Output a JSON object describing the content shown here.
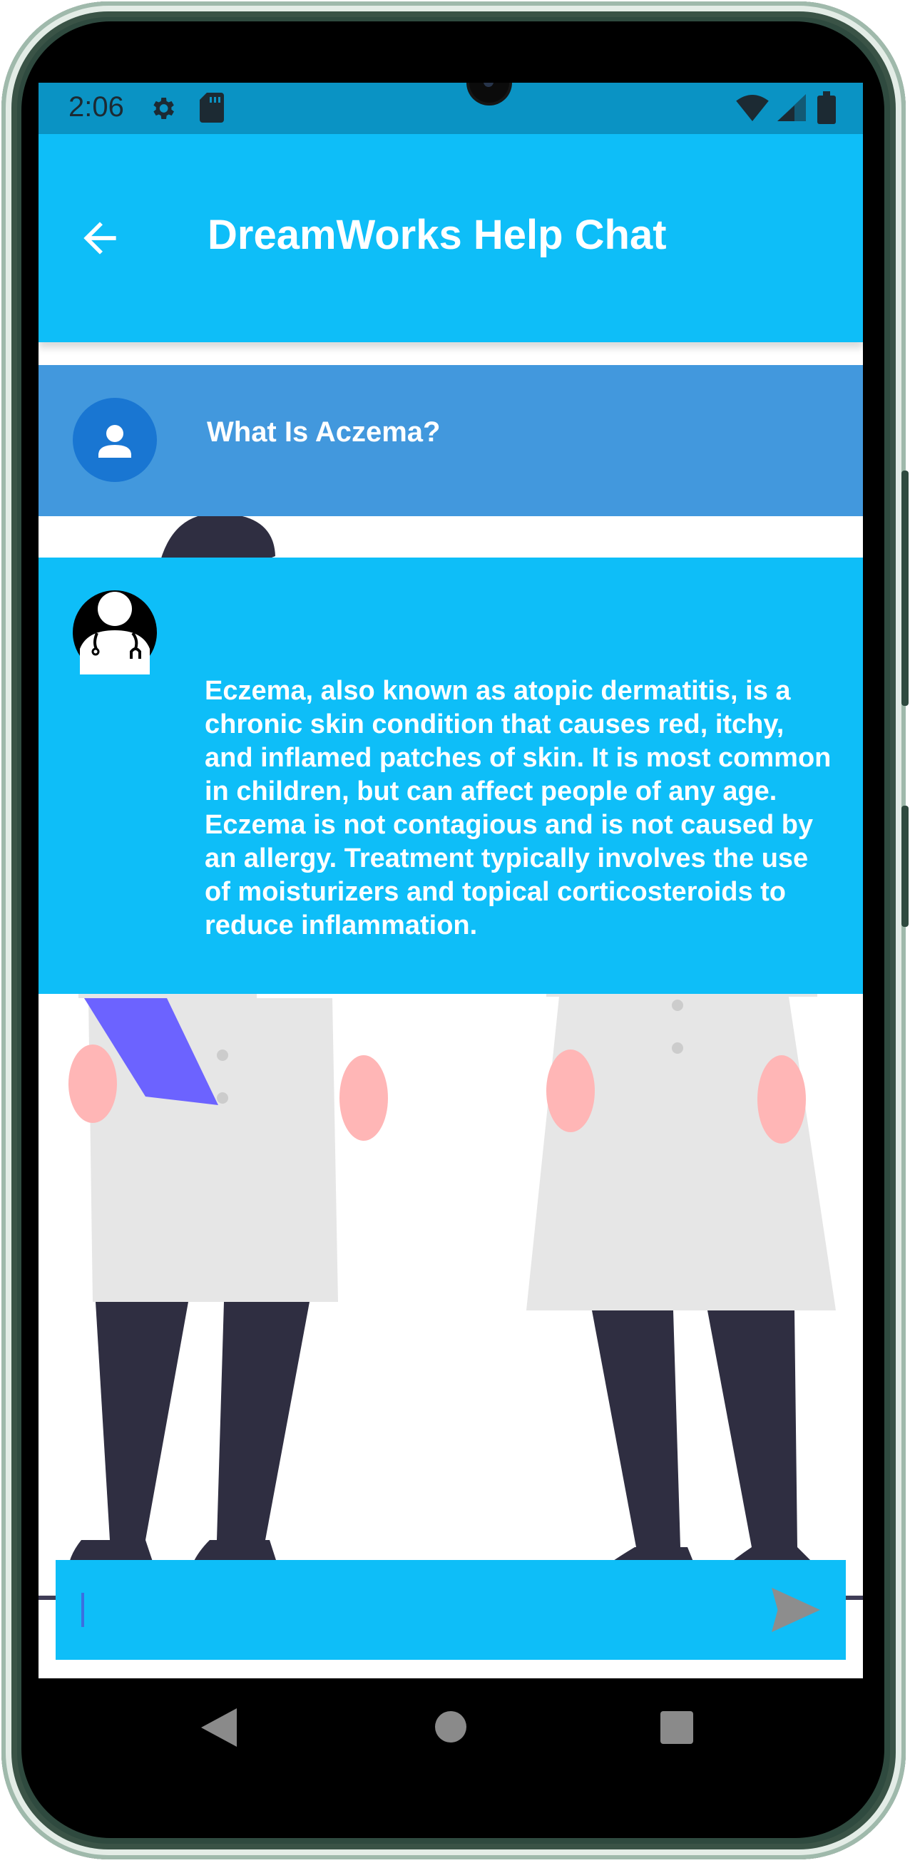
{
  "status_bar": {
    "time": "2:06",
    "icons": [
      "gear-icon",
      "sd-card-icon",
      "wifi-icon",
      "signal-icon",
      "battery-icon"
    ]
  },
  "app_bar": {
    "title": "DreamWorks Help Chat",
    "back_icon": "arrow-left-icon"
  },
  "messages": [
    {
      "role": "user",
      "avatar_icon": "person-icon",
      "text": "What Is Aczema?"
    },
    {
      "role": "bot",
      "avatar_icon": "doctor-icon",
      "text": "Eczema, also known as atopic dermatitis, is a chronic skin condition that causes red, itchy, and inflamed patches of skin. It is most common in children, but can affect people of any age. Eczema is not contagious and is not caused by an allergy. Treatment typically involves the use of moisturizers and topical corticosteroids to reduce inflammation."
    }
  ],
  "input": {
    "value": "",
    "placeholder": "",
    "send_icon": "send-icon"
  },
  "nav": {
    "icons": [
      "nav-back-icon",
      "nav-home-icon",
      "nav-recents-icon"
    ]
  },
  "colors": {
    "app_bar": "#0ebef8",
    "status_bar": "#0a93c4",
    "user_bubble": "#4298dd",
    "user_avatar": "#1976d2",
    "bot_bubble": "#0ebef8"
  }
}
